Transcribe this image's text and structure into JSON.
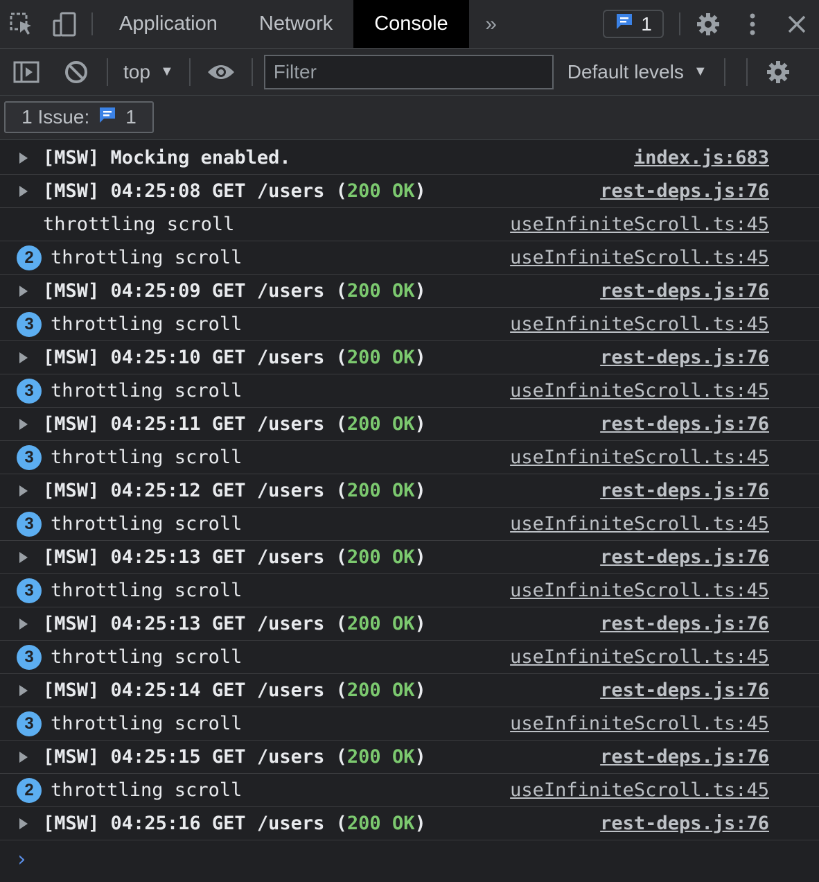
{
  "tabs": {
    "application": "Application",
    "network": "Network",
    "console": "Console",
    "more": "»",
    "issues_count": "1"
  },
  "toolbar": {
    "context": "top",
    "filter_placeholder": "Filter",
    "levels": "Default levels"
  },
  "issues_bar": {
    "label": "1 Issue:",
    "count": "1"
  },
  "log": {
    "first": {
      "text": "[MSW] Mocking enabled.",
      "source": "index.js:683"
    },
    "rows": [
      {
        "type": "msw",
        "time": "04:25:08",
        "source": "rest-deps.js:76"
      },
      {
        "type": "plain",
        "text": "throttling scroll",
        "source": "useInfiniteScroll.ts:45"
      },
      {
        "type": "count",
        "count": "2",
        "text": "throttling scroll",
        "source": "useInfiniteScroll.ts:45"
      },
      {
        "type": "msw",
        "time": "04:25:09",
        "source": "rest-deps.js:76"
      },
      {
        "type": "count",
        "count": "3",
        "text": "throttling scroll",
        "source": "useInfiniteScroll.ts:45"
      },
      {
        "type": "msw",
        "time": "04:25:10",
        "source": "rest-deps.js:76"
      },
      {
        "type": "count",
        "count": "3",
        "text": "throttling scroll",
        "source": "useInfiniteScroll.ts:45"
      },
      {
        "type": "msw",
        "time": "04:25:11",
        "source": "rest-deps.js:76"
      },
      {
        "type": "count",
        "count": "3",
        "text": "throttling scroll",
        "source": "useInfiniteScroll.ts:45"
      },
      {
        "type": "msw",
        "time": "04:25:12",
        "source": "rest-deps.js:76"
      },
      {
        "type": "count",
        "count": "3",
        "text": "throttling scroll",
        "source": "useInfiniteScroll.ts:45"
      },
      {
        "type": "msw",
        "time": "04:25:13",
        "source": "rest-deps.js:76"
      },
      {
        "type": "count",
        "count": "3",
        "text": "throttling scroll",
        "source": "useInfiniteScroll.ts:45"
      },
      {
        "type": "msw",
        "time": "04:25:13",
        "source": "rest-deps.js:76"
      },
      {
        "type": "count",
        "count": "3",
        "text": "throttling scroll",
        "source": "useInfiniteScroll.ts:45"
      },
      {
        "type": "msw",
        "time": "04:25:14",
        "source": "rest-deps.js:76"
      },
      {
        "type": "count",
        "count": "3",
        "text": "throttling scroll",
        "source": "useInfiniteScroll.ts:45"
      },
      {
        "type": "msw",
        "time": "04:25:15",
        "source": "rest-deps.js:76"
      },
      {
        "type": "count",
        "count": "2",
        "text": "throttling scroll",
        "source": "useInfiniteScroll.ts:45"
      },
      {
        "type": "msw",
        "time": "04:25:16",
        "source": "rest-deps.js:76"
      }
    ],
    "msw": {
      "prefix": "[MSW] ",
      "method": " GET /users (",
      "status_code": "200",
      "space": " ",
      "status_text": "OK",
      "close": ")"
    }
  },
  "prompt": "›",
  "colors": {
    "error": "#f2643a",
    "ok": "#7cc96f",
    "badge": "#5caef1",
    "prompt": "#5a8ee6"
  }
}
